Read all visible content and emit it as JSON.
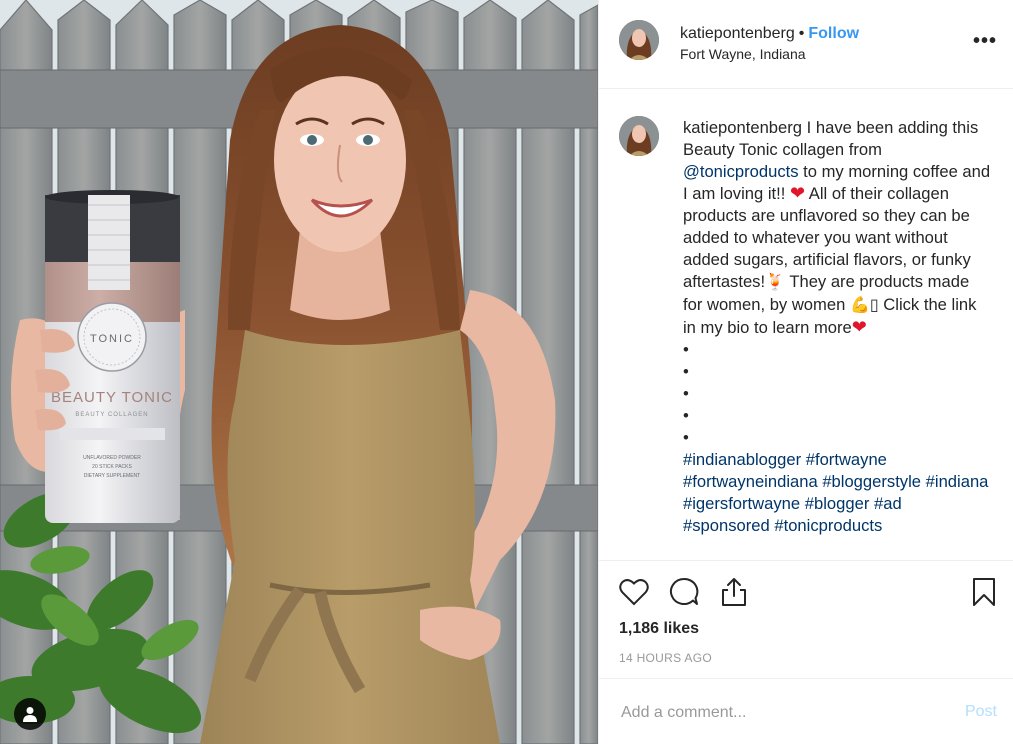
{
  "post": {
    "username": "katiepontenberg",
    "separator": "•",
    "follow_label": "Follow",
    "location": "Fort Wayne, Indiana",
    "more_label": "•••"
  },
  "product": {
    "brand": "TONIC",
    "title": "BEAUTY TONIC",
    "subtitle": "BEAUTY COLLAGEN",
    "line1": "UNFLAVORED POWDER",
    "line2": "20 STICK PACKS",
    "line3": "DIETARY SUPPLEMENT"
  },
  "caption": {
    "username": "katiepontenberg",
    "t1": " I have been adding this Beauty Tonic collagen from ",
    "mention": "@tonicproducts",
    "t2": " to my morning coffee and I am loving it!! ",
    "e1": "❤",
    "t3": " All of their collagen products are unflavored so they can be added to whatever you want without added sugars, artificial flavors, or funky aftertastes!",
    "e2": "🍹",
    "t4": " They are products made for women, by women ",
    "e3": "💪",
    "e4": "▯",
    "t5": " Click the link in my bio to learn more",
    "e5": "❤",
    "bullets": [
      "•",
      "•",
      "•",
      "•",
      "•"
    ],
    "hashtags": [
      "#indianablogger",
      "#fortwayne",
      "#fortwayneindiana",
      "#bloggerstyle",
      "#indiana",
      "#igersfortwayne",
      "#blogger",
      "#ad",
      "#sponsored",
      "#tonicproducts"
    ]
  },
  "icons": {
    "like": "heart-icon",
    "comment": "comment-icon",
    "share": "share-icon",
    "save": "bookmark-icon",
    "tag": "user-tag-icon"
  },
  "stats": {
    "likes": "1,186 likes",
    "time": "14 HOURS AGO"
  },
  "comment_box": {
    "placeholder": "Add a comment...",
    "post_label": "Post"
  },
  "colors": {
    "link_blue": "#3897f0",
    "hashtag": "#003569",
    "post_disabled": "#b2dffc",
    "heart_red": "#e0162b"
  }
}
